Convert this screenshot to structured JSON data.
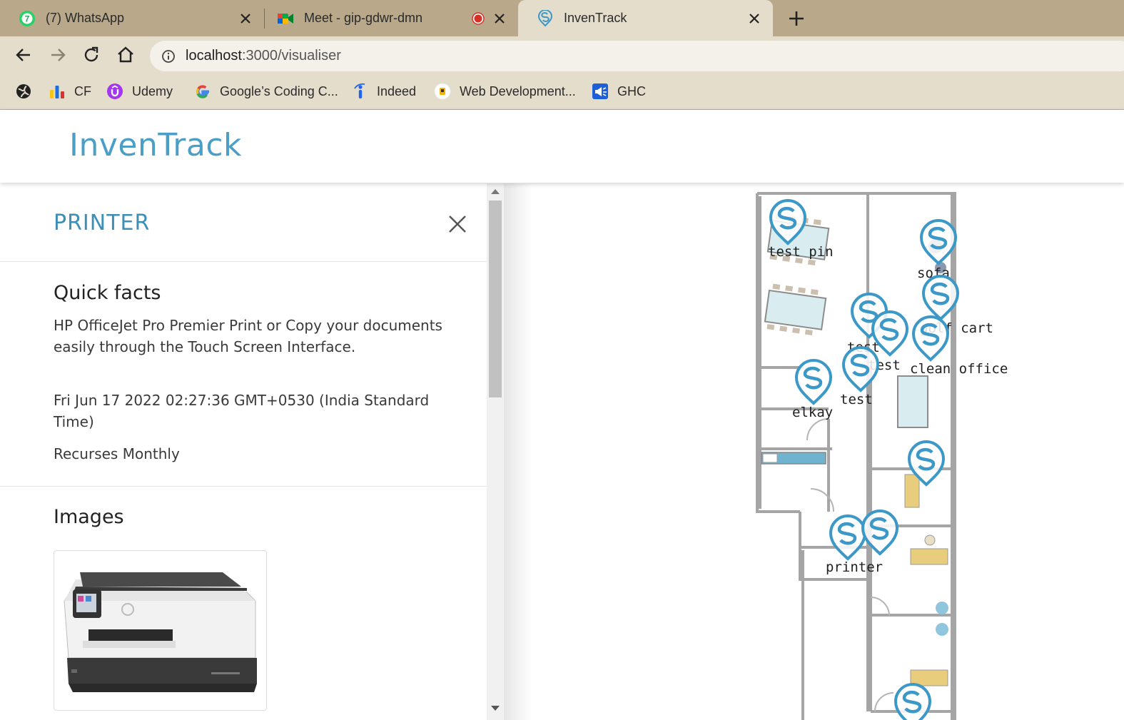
{
  "browser": {
    "tabs": [
      {
        "title": "(7) WhatsApp",
        "badge": "7",
        "icon": "whatsapp-icon"
      },
      {
        "title": "Meet - gip-gdwr-dmn",
        "icon": "google-meet-icon",
        "recording": true
      },
      {
        "title": "InvenTrack",
        "icon": "inventrack-icon",
        "active": true
      }
    ],
    "url_host": "localhost",
    "url_path": ":3000/visualiser",
    "bookmarks": [
      {
        "label": "",
        "icon": "globe-icon"
      },
      {
        "label": "CF",
        "icon": "codeforces-icon"
      },
      {
        "label": "Udemy",
        "icon": "udemy-icon"
      },
      {
        "label": "Google’s Coding C...",
        "icon": "google-icon"
      },
      {
        "label": "Indeed",
        "icon": "indeed-icon"
      },
      {
        "label": "Web Development...",
        "icon": "web-dev-icon"
      },
      {
        "label": "GHC",
        "icon": "ghc-icon"
      }
    ]
  },
  "app": {
    "brand": "InvenTrack"
  },
  "panel": {
    "title": "PRINTER",
    "quick_facts_heading": "Quick facts",
    "description": "HP OfficeJet Pro Premier Print or Copy your documents easily through the Touch Screen Interface.",
    "timestamp": "Fri Jun 17 2022 02:27:36 GMT+0530 (India Standard Time)",
    "recurrence": "Recurses Monthly",
    "images_heading": "Images"
  },
  "map": {
    "pins": [
      {
        "label": "test pin"
      },
      {
        "label": "sofa"
      },
      {
        "label": "golf cart"
      },
      {
        "label": "test"
      },
      {
        "label": "test"
      },
      {
        "label": "clean office"
      },
      {
        "label": "test"
      },
      {
        "label": "elkay"
      },
      {
        "label": "printer"
      }
    ],
    "pin_color": "#3b98c7"
  },
  "colors": {
    "brand": "#4b9fc7",
    "chrome_tabbar": "#b9a98a",
    "chrome_toolbar": "#e5ddcc"
  }
}
